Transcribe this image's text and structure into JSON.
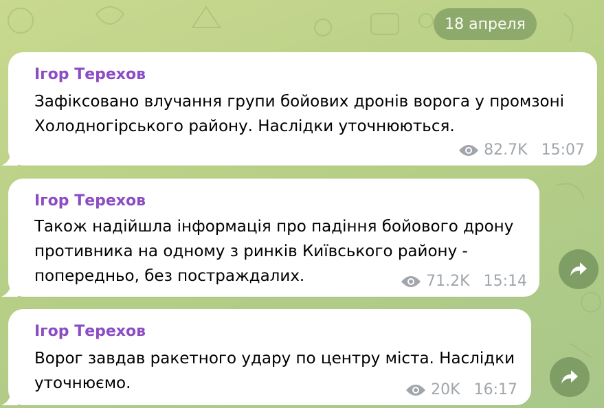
{
  "date_label": "18 апреля",
  "messages": [
    {
      "sender": "Ігор Терехов",
      "text": "Зафіксовано влучання групи бойових дронів ворога у промзоні\nХолодногірського району. Наслідки уточнюються.",
      "views": "82.7K",
      "time": "15:07",
      "has_share": false
    },
    {
      "sender": "Ігор Терехов",
      "text": "Також надійшла інформація про падіння бойового дрону\nпротивника на одному з ринків Київського району -\nпопередньо, без постраждалих.",
      "views": "71.2K",
      "time": "15:14",
      "has_share": true
    },
    {
      "sender": "Ігор Терехов",
      "text": "Ворог завдав ракетного удару по центру міста. Наслідки\nуточнюємо.",
      "views": "20K",
      "time": "16:17",
      "has_share": true
    }
  ],
  "icons": {
    "views": "eye-icon",
    "share": "share-arrow-icon"
  },
  "colors": {
    "sender": "#8b4cc4",
    "meta": "#a0a6ab",
    "bubble": "#ffffff",
    "share_button": "#7e9e66",
    "date_pill": "#8aa66a"
  }
}
